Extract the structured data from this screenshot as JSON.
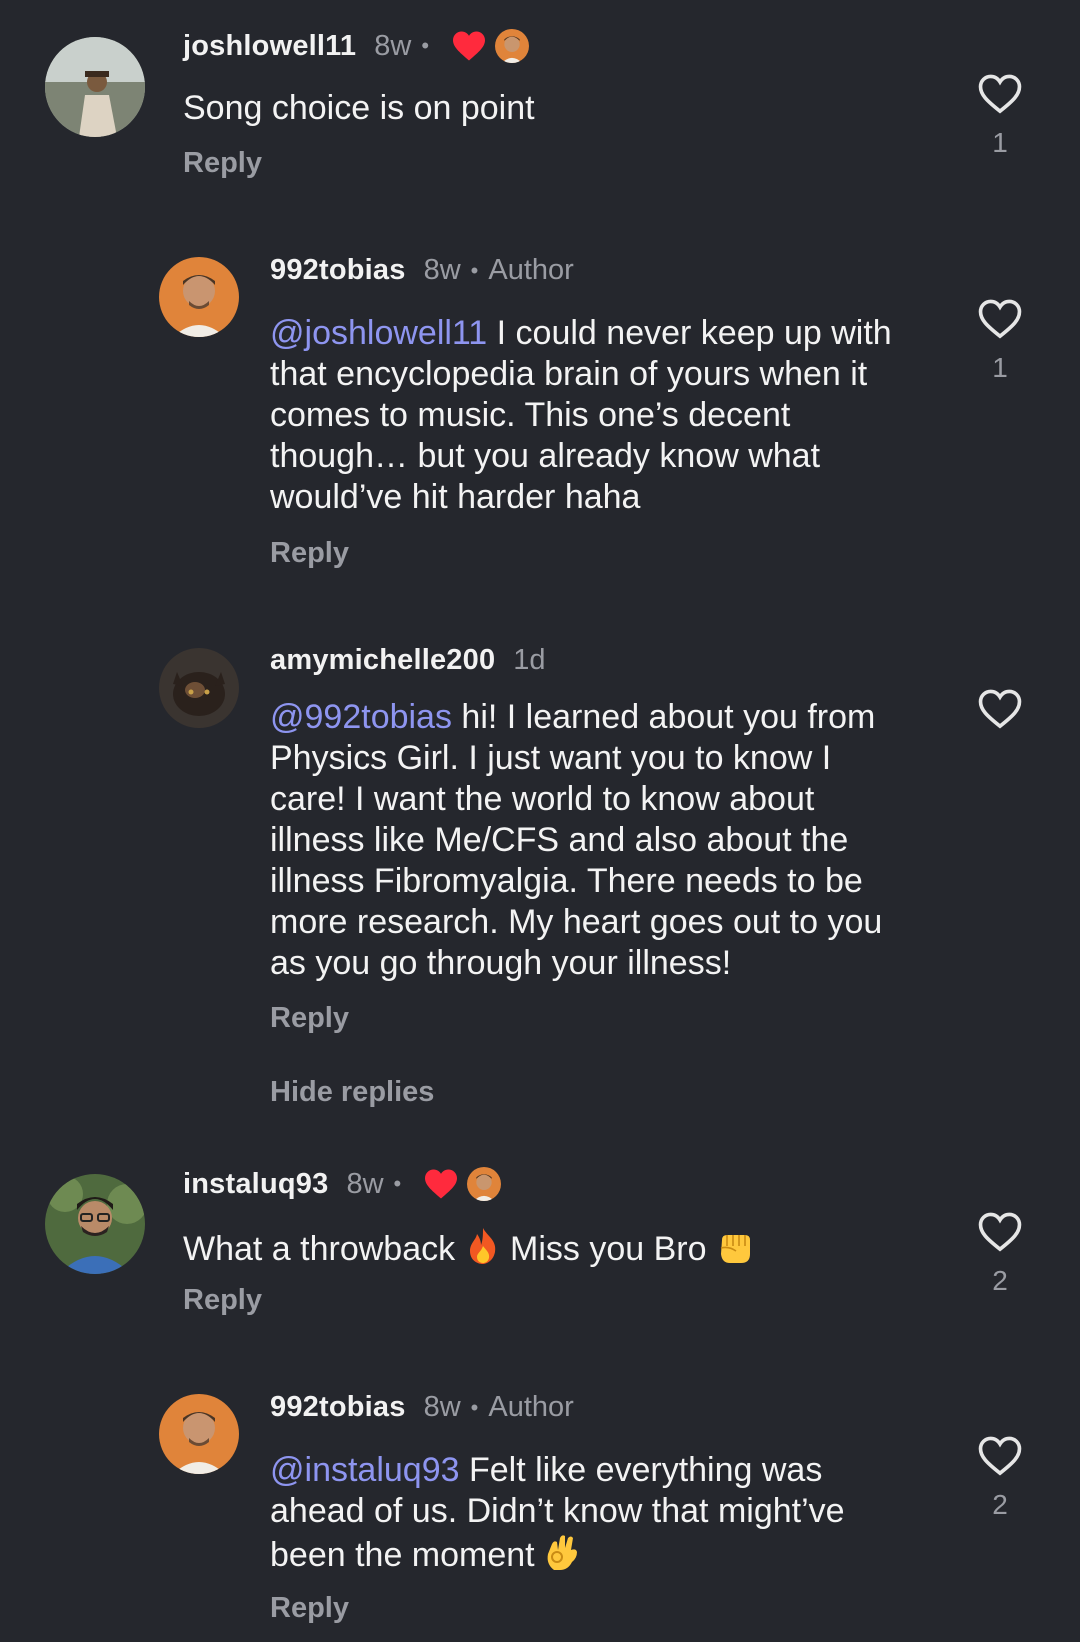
{
  "comments": [
    {
      "username": "joshlowell11",
      "time": "8w",
      "liked_by_author": true,
      "text": "Song choice is on point",
      "reply_label": "Reply",
      "likes": "1"
    },
    {
      "username": "992tobias",
      "time": "8w",
      "badge": "Author",
      "mention": "@joshlowell11",
      "line1": " I could never keep up with",
      "line2": "that encyclopedia brain of yours when it",
      "line3": "comes to music. This one’s decent",
      "line4": "though… but you already know what",
      "line5": "would’ve hit harder haha",
      "reply_label": "Reply",
      "likes": "1"
    },
    {
      "username": "amymichelle200",
      "time": "1d",
      "mention": "@992tobias",
      "line1": " hi! I learned about you from",
      "line2": "Physics Girl. I just want you to know I",
      "line3": "care! I want the world to know about",
      "line4": "illness like Me/CFS and also about the",
      "line5": "illness Fibromyalgia. There needs to be",
      "line6": "more research. My heart goes out to you",
      "line7": "as you go through your illness!",
      "reply_label": "Reply",
      "likes": ""
    },
    {
      "username": "instaluq93",
      "time": "8w",
      "liked_by_author": true,
      "text_a": "What a throwback ",
      "text_b": " Miss you Bro ",
      "reply_label": "Reply",
      "likes": "2"
    },
    {
      "username": "992tobias",
      "time": "8w",
      "badge": "Author",
      "mention": "@instaluq93",
      "line1": " Felt like everything was",
      "line2": "ahead of us. Didn’t know that might’ve",
      "line3": "been the moment ",
      "reply_label": "Reply",
      "likes": "2"
    }
  ],
  "hide_replies_label": "Hide replies",
  "separator": "•",
  "icons": {
    "like": "heart-outline-icon",
    "liked": "heart-filled-icon",
    "fire": "fire-emoji",
    "fist": "fist-emoji",
    "ok": "ok-hand-emoji"
  },
  "colors": {
    "background": "#25272d",
    "mention": "#8e95f0",
    "muted": "#9a9ca3",
    "liked_heart": "#ff2a3d"
  }
}
